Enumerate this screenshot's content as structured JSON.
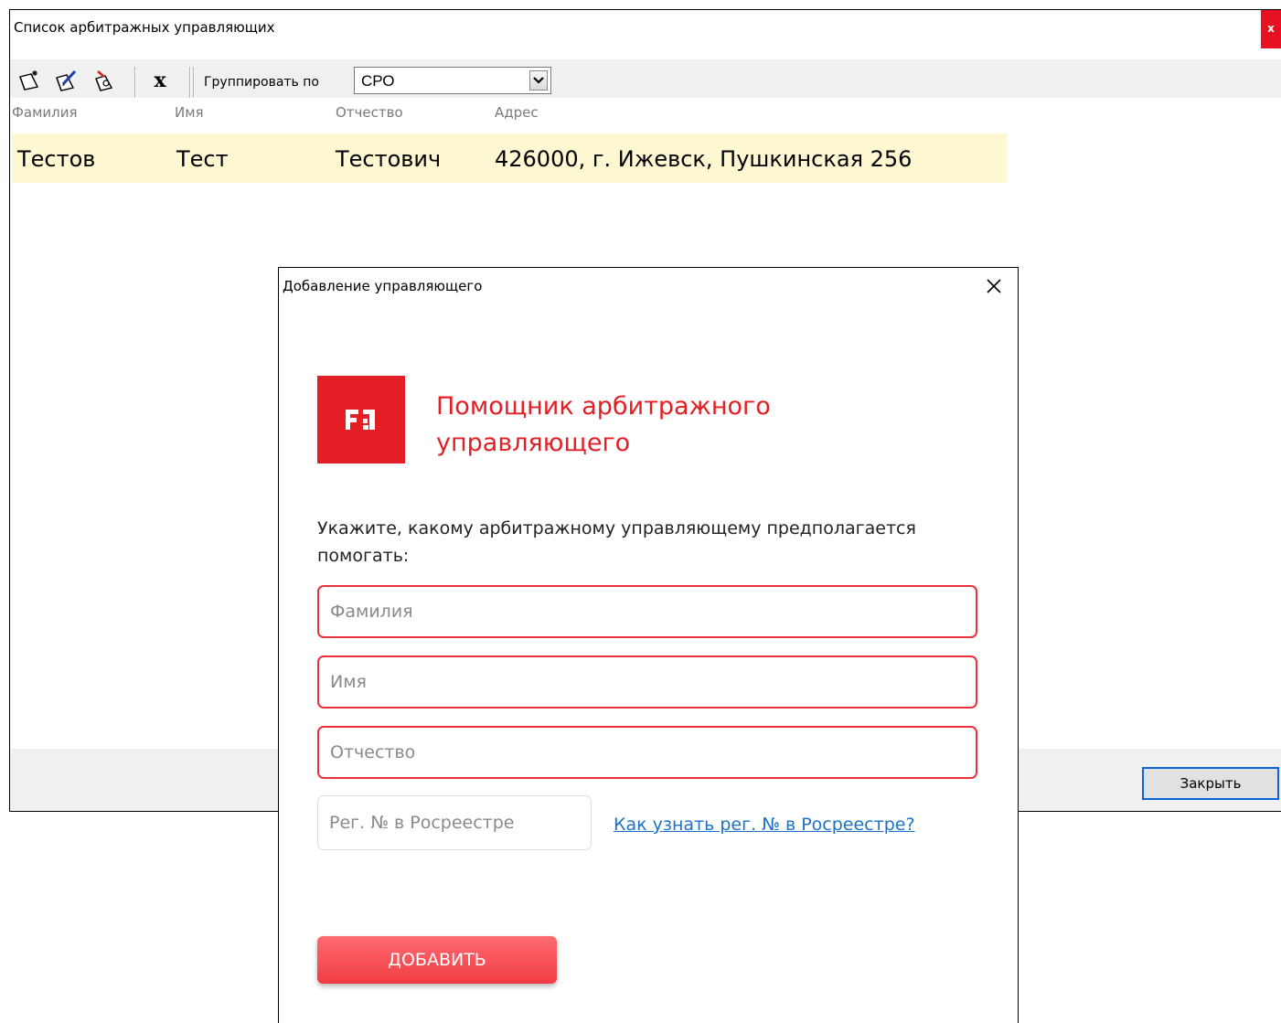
{
  "main_window": {
    "title": "Список арбитражных управляющих",
    "close_glyph": "x",
    "toolbar": {
      "icons": [
        "add-record-icon",
        "edit-record-icon",
        "view-record-icon"
      ],
      "delete_glyph": "x",
      "group_by_label": "Группировать по",
      "group_by_value": "СРО"
    },
    "columns": [
      "Фамилия",
      "Имя",
      "Отчество",
      "Адрес"
    ],
    "rows": [
      {
        "last_name": "Тестов",
        "first_name": "Тест",
        "patronymic": "Тестович",
        "address": "426000, г. Ижевск, Пушкинская 256"
      }
    ],
    "close_button_label": "Закрыть"
  },
  "dialog": {
    "title": "Добавление управляющего",
    "brand_title": "Помощник арбитражного управляющего",
    "prompt": "Укажите, какому арбитражному управляющему предполагается помогать:",
    "fields": {
      "last_name_placeholder": "Фамилия",
      "first_name_placeholder": "Имя",
      "patronymic_placeholder": "Отчество",
      "reg_number_placeholder": "Рег. № в Росреестре"
    },
    "reg_help_link": "Как узнать рег. № в Росреестре?",
    "add_button_label": "ДОБАВИТЬ"
  },
  "colors": {
    "brand_red": "#e31e24",
    "field_border": "#e8323b",
    "row_highlight": "#fdf7d2",
    "link_blue": "#1a73c7"
  }
}
